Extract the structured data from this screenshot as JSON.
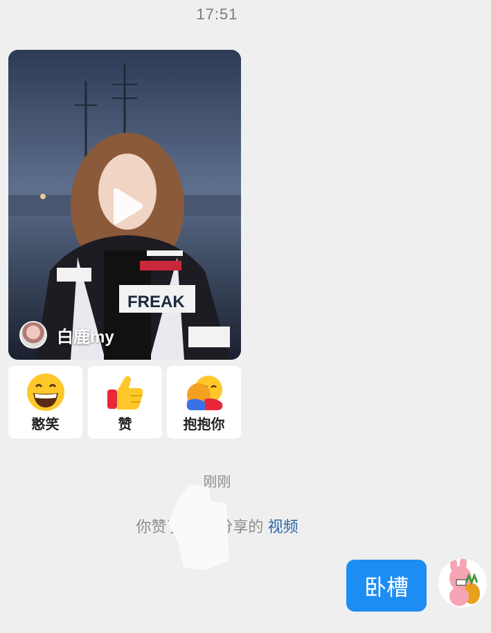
{
  "chat": {
    "top_time": "17:51",
    "video_card": {
      "author_name": "白鹿my",
      "jacket_text": "FREAK"
    },
    "reactions": [
      {
        "label": "憨笑",
        "icon": "grin-emoji-icon"
      },
      {
        "label": "赞",
        "icon": "thumbs-up-emoji-icon"
      },
      {
        "label": "抱抱你",
        "icon": "hug-emoji-icon"
      }
    ],
    "system_time": "刚刚",
    "notice_prefix": "你赞了",
    "notice_suffix": "分享的",
    "notice_link": "视频",
    "my_message": "卧槽"
  },
  "colors": {
    "background": "#efefef",
    "bubble": "#1d8df4",
    "link": "#2a64a8"
  }
}
